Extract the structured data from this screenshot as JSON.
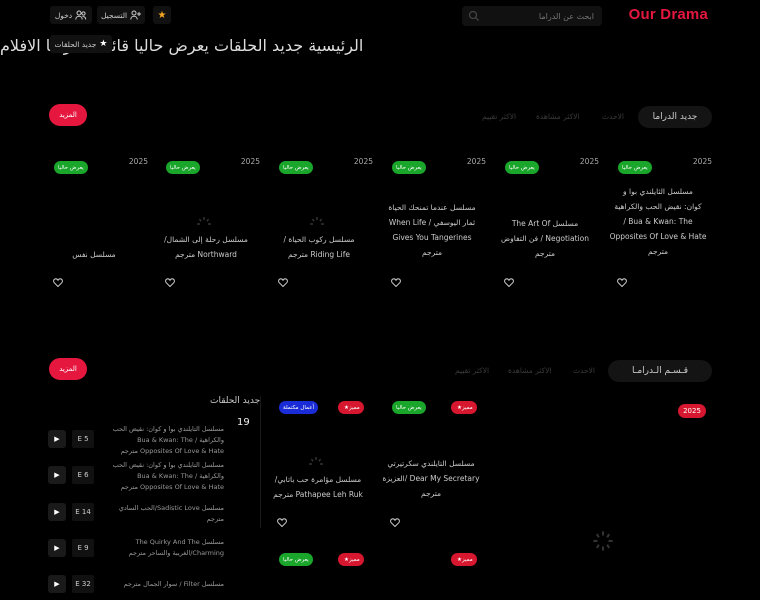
{
  "header": {
    "logo": "Our Drama",
    "search_placeholder": "ابحث عن الدراما",
    "register_label": "التسجيل",
    "login_label": "دخول"
  },
  "nav": {
    "items": [
      "الرئيسية",
      "جديد الحلقات",
      "يعرض حاليا",
      "قائمة الدراما",
      "الافلام"
    ],
    "new_episodes_button": "جديد الحلقات"
  },
  "section1": {
    "title": "جديد الدراما",
    "tabs": [
      "الاحدث",
      "الاكثر مشاهدة",
      "الاكثر تقييم"
    ],
    "more_label": "المزيد",
    "cards": [
      {
        "year": "2025",
        "badge": "يعرض حاليا",
        "title_lines": [
          "مسلسل الثايلندي بوا و",
          "كوان: نقيض الحب والكراهية",
          "Bua & Kwan: The /",
          "Opposites Of Love & Hate",
          "مترجم"
        ]
      },
      {
        "year": "2025",
        "badge": "يعرض حاليا",
        "title_lines": [
          "مسلسل The Art Of",
          "Negotiation / فن التفاوض",
          "مترجم"
        ]
      },
      {
        "year": "2025",
        "badge": "يعرض حاليا",
        "title_lines": [
          "مسلسل عندما تمنحك الحياة",
          "ثمار اليوسفي / When Life",
          "Gives You Tangerines",
          "مترجم"
        ]
      },
      {
        "year": "2025",
        "badge": "يعرض حاليا",
        "title_lines": [
          "مسلسل ركوب الحياة /",
          "Riding Life مترجم"
        ]
      },
      {
        "year": "2025",
        "badge": "يعرض حاليا",
        "title_lines": [
          "مسلسل رحلة إلى الشمال/",
          "Northward مترجم"
        ]
      },
      {
        "year": "2025",
        "badge": "يعرض حاليا",
        "title_lines": [
          "مسلسل نفس"
        ]
      }
    ]
  },
  "section2": {
    "title": "قـسـم الـدرامـا",
    "tabs": [
      "الاحدث",
      "الاكثر مشاهدة",
      "الاكثر تقييم"
    ],
    "more_label": "المزيد",
    "year": "2025",
    "cards": [
      {
        "badges": [
          "يعرض حاليا",
          "مميز"
        ],
        "title_lines": [
          "مسلسل التايلندي سكرتيرتي",
          "Dear My Secretary /العزيزة",
          "مترجم"
        ]
      },
      {
        "badges": [
          "مميز",
          "أعمال مكتملة"
        ],
        "title_lines": [
          "مسلسل مؤامرة حب باتابي/",
          "Pathapee Leh Ruk مترجم"
        ]
      }
    ],
    "bottom_badges": [
      "مميز",
      "مميز",
      "يعرض حاليا"
    ]
  },
  "new_episodes": {
    "title": "جديد الحلقات",
    "count": "19",
    "items": [
      {
        "ep": "E 5",
        "title": "مسلسل التايلندي بوا و كوان: نقيض الحب والكراهية Bua & Kwan: The / Opposites Of Love & Hate مترجم"
      },
      {
        "ep": "E 6",
        "title": "مسلسل التايلندي بوا و كوان: نقيض الحب والكراهية Bua & Kwan: The / Opposites Of Love & Hate مترجم"
      },
      {
        "ep": "E 14",
        "title": "مسلسل Sadistic Love/الحب السادي مترجم"
      },
      {
        "ep": "E 9",
        "title": "مسلسل The Quirky And The Charming/الغريبة والساحر مترجم"
      },
      {
        "ep": "E 32",
        "title": "مسلسل Filter / سوار الجمال مترجم"
      }
    ]
  },
  "colors": {
    "brand": "#e5173f",
    "green_badge": "#1aa52b",
    "red_badge": "#d6172f",
    "blue_badge": "#1a2cd8",
    "star": "#f5a623"
  }
}
